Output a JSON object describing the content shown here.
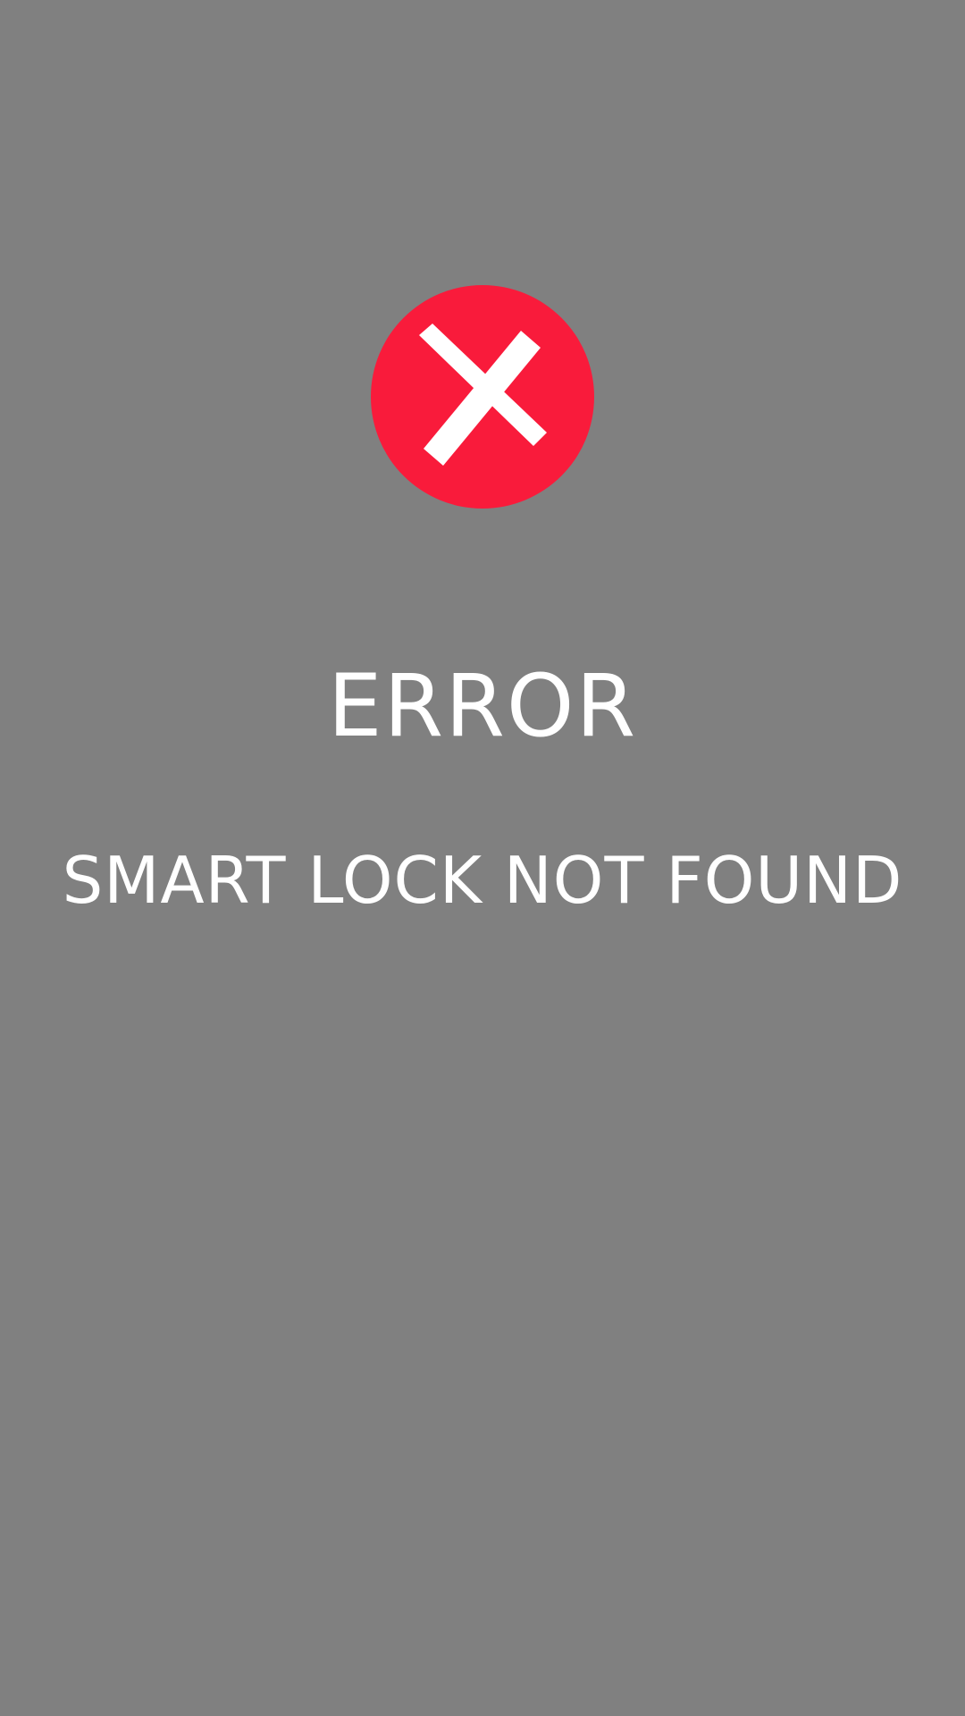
{
  "screen": {
    "background_color": "#808080",
    "icon": {
      "name": "error-x-icon",
      "color": "#f91b3b",
      "glyph_color": "#ffffff"
    },
    "title": "ERROR",
    "message": "SMART LOCK NOT FOUND"
  }
}
